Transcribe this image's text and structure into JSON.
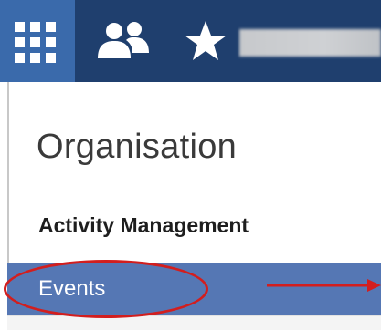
{
  "topbar": {
    "apps_icon": "app-launcher-grid-icon",
    "people_icon": "people-icon",
    "favourites_icon": "star-icon",
    "blurred_item_icon": "redacted-item",
    "colors": {
      "bar": "#1f3f6e",
      "apps_tile": "#3a6aab"
    }
  },
  "menu": {
    "title": "Organisation",
    "section_heading": "Activity Management",
    "items": [
      {
        "label": "Events",
        "selected": true
      }
    ],
    "colors": {
      "selected_row": "#5577b4"
    }
  },
  "annotations": {
    "highlight_color": "#d21e1e",
    "ellipse_target": "Events",
    "arrow_icon": "red-arrow-right"
  }
}
